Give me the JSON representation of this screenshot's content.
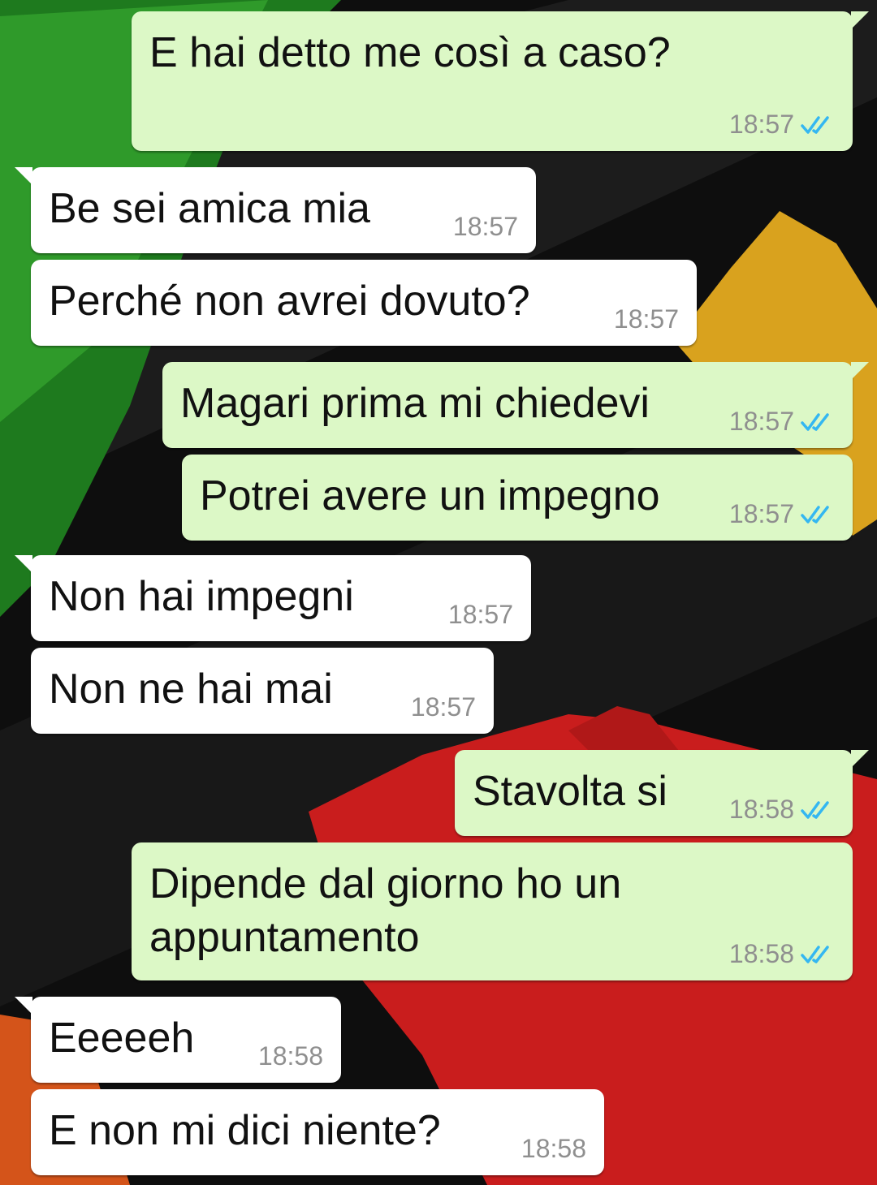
{
  "chat": {
    "messages": [
      {
        "direction": "out",
        "text": "E hai detto me così a caso?",
        "time": "18:57",
        "status": "read"
      },
      {
        "direction": "in",
        "text": "Be sei amica mia",
        "time": "18:57"
      },
      {
        "direction": "in",
        "text": "Perché non avrei dovuto?",
        "time": "18:57"
      },
      {
        "direction": "out",
        "text": "Magari prima mi chiedevi",
        "time": "18:57",
        "status": "read"
      },
      {
        "direction": "out",
        "text": "Potrei avere un impegno",
        "time": "18:57",
        "status": "read"
      },
      {
        "direction": "in",
        "text": "Non hai impegni",
        "time": "18:57"
      },
      {
        "direction": "in",
        "text": "Non ne hai mai",
        "time": "18:57"
      },
      {
        "direction": "out",
        "text": "Stavolta si",
        "time": "18:58",
        "status": "read"
      },
      {
        "direction": "out",
        "text": "Dipende dal giorno ho un\nappuntamento",
        "time": "18:58",
        "status": "read"
      },
      {
        "direction": "in",
        "text": "Eeeeeh",
        "time": "18:58"
      },
      {
        "direction": "in",
        "text": "E non mi dici niente?",
        "time": "18:58"
      }
    ]
  },
  "colors": {
    "incoming_bubble": "#ffffff",
    "outgoing_bubble": "#dcf8c6",
    "read_check": "#34b7f1",
    "timestamp": "#8f8f8f"
  },
  "icons": {
    "read_receipt": "double-check-icon"
  }
}
